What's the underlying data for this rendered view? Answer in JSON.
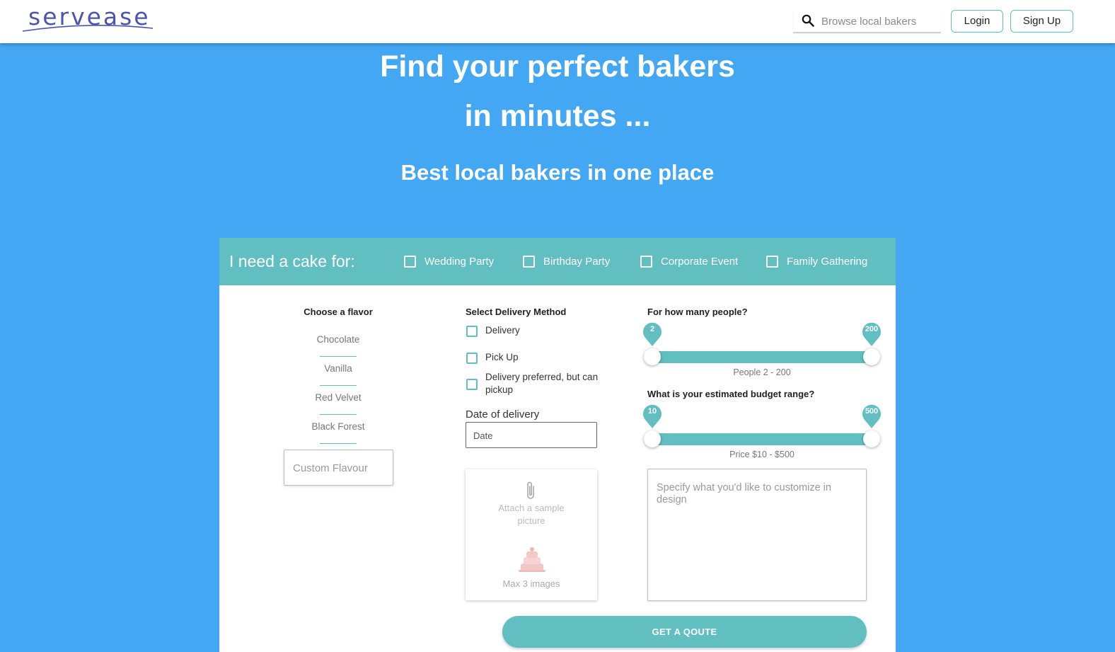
{
  "brand": {
    "logo_text": "servease",
    "accent": "#62bfc1",
    "hero_bg": "#43a7f3",
    "logo_color": "#4b55b0"
  },
  "header": {
    "search_placeholder": "Browse local bakers",
    "login_label": "Login",
    "signup_label": "Sign Up"
  },
  "hero": {
    "title_line1": "Find your perfect bakers",
    "title_line2": "in minutes ...",
    "subtitle": "Best local bakers in one place"
  },
  "form": {
    "need_label": "I need a cake for:",
    "occasions": [
      {
        "label": "Wedding Party",
        "checked": false
      },
      {
        "label": "Birthday Party",
        "checked": false
      },
      {
        "label": "Corporate Event",
        "checked": false
      },
      {
        "label": "Family Gathering",
        "checked": false
      }
    ],
    "flavor": {
      "title": "Choose a flavor",
      "options": [
        "Chocolate",
        "Vanilla",
        "Red Velvet",
        "Black Forest"
      ],
      "custom_placeholder": "Custom Flavour"
    },
    "delivery": {
      "title": "Select Delivery Method",
      "options": [
        "Delivery",
        "Pick Up",
        "Delivery preferred, but can pickup"
      ],
      "date_label": "Date of delivery",
      "date_placeholder": "Date"
    },
    "attach": {
      "icon": "paperclip-icon",
      "text": "Attach a sample picture",
      "max": "Max 3 images"
    },
    "people": {
      "title": "For how many people?",
      "min": 2,
      "max": 200,
      "min_label": "2",
      "max_label": "200",
      "caption": "People 2 - 200"
    },
    "budget": {
      "title": "What is your estimated budget range?",
      "min": 10,
      "max": 500,
      "min_label": "10",
      "max_label": "500",
      "caption": "Price $10 - $500"
    },
    "design_placeholder": "Specify what you'd like to customize in design",
    "submit_label": "GET A QOUTE"
  }
}
